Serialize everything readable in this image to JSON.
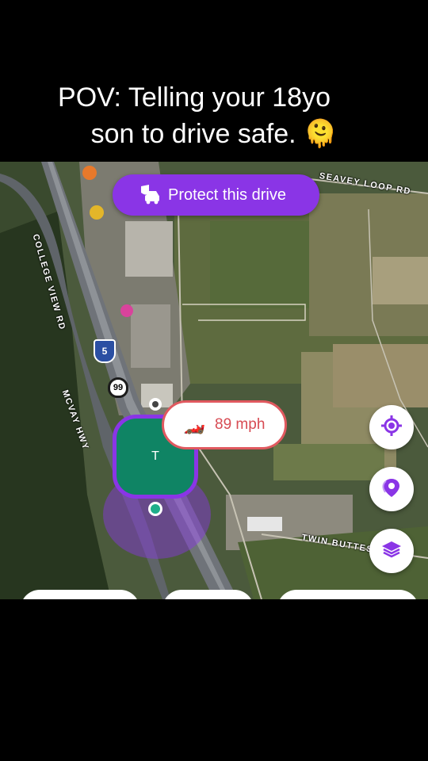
{
  "caption": {
    "line1": "POV: Telling your 18yo",
    "line2": "son to drive safe. 🫠"
  },
  "map": {
    "protect_button_label": "Protect this drive",
    "road_labels": {
      "seavey": "SEAVEY LOOP RD",
      "college_view": "COLLEGE VIEW RD",
      "mcvay": "MCVAY HWY",
      "twin_buttes": "TWIN BUTTES"
    },
    "shields": {
      "interstate": "5",
      "route": "99"
    },
    "speed": {
      "car_icon": "race-car-icon",
      "value": "89 mph"
    },
    "avatar_initial": "T",
    "accent_color": "#8a35e6",
    "speed_color": "#d74b53"
  }
}
